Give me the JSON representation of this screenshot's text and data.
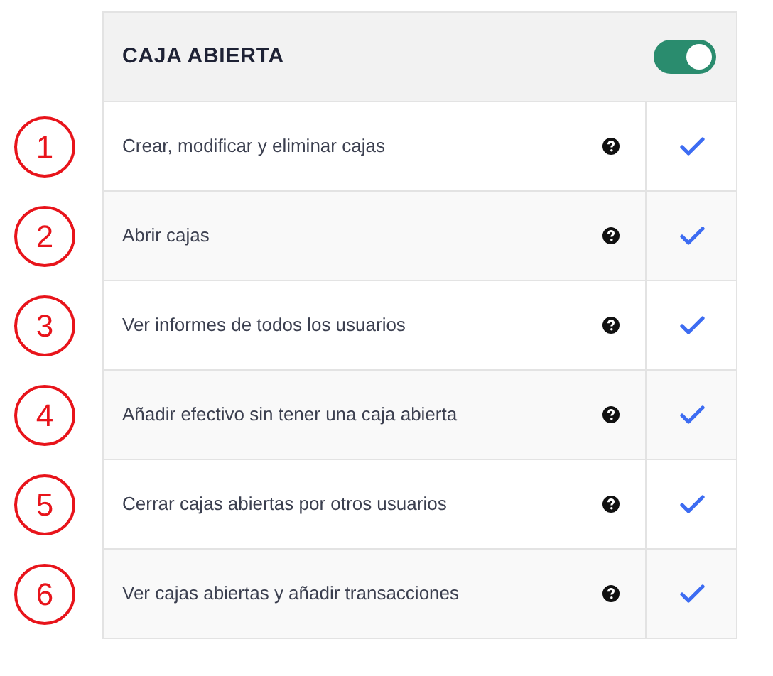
{
  "panel": {
    "title": "CAJA ABIERTA",
    "enabled": true
  },
  "permissions": [
    {
      "marker": "1",
      "label": "Crear, modificar y eliminar cajas",
      "checked": true
    },
    {
      "marker": "2",
      "label": "Abrir cajas",
      "checked": true
    },
    {
      "marker": "3",
      "label": "Ver informes de todos los usuarios",
      "checked": true
    },
    {
      "marker": "4",
      "label": "Añadir efectivo sin tener una caja abierta",
      "checked": true
    },
    {
      "marker": "5",
      "label": "Cerrar cajas abiertas por otros usuarios",
      "checked": true
    },
    {
      "marker": "6",
      "label": "Ver cajas abiertas y añadir transacciones",
      "checked": true
    }
  ]
}
